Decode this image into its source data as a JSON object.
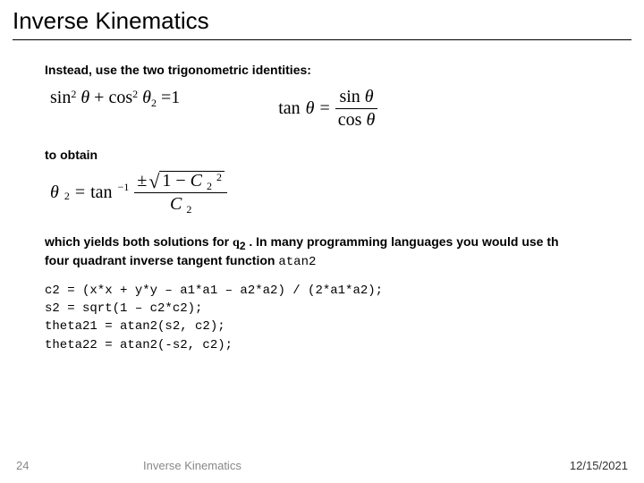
{
  "title": "Inverse Kinematics",
  "intro": "Instead, use the two trigonometric identities:",
  "eq1": {
    "sin": "sin",
    "sq1": "2",
    "theta1": "θ",
    "plus": "+",
    "cos": "cos",
    "sq2": "2",
    "theta2": "θ",
    "sub2": "2",
    "eq": "=",
    "one": "1"
  },
  "eq2": {
    "tan": "tan",
    "theta": "θ",
    "eq": "=",
    "num_sin": "sin",
    "num_theta": "θ",
    "den_cos": "cos",
    "den_theta": "θ"
  },
  "to_obtain": "to obtain",
  "eq3": {
    "theta": "θ",
    "sub2": "2",
    "eq": "=",
    "tan": "tan",
    "inv": "−1",
    "pm": "±",
    "one": "1",
    "minus": "−",
    "C": "C",
    "Csub": "2",
    "Csq": "2",
    "denC": "C",
    "denCsub": "2"
  },
  "para": {
    "t1": "which yields both solutions for ",
    "sym": "q",
    "sub": "2",
    "t2": " . In many programming languages you would use th",
    "t3": "four quadrant inverse tangent function ",
    "fn": "atan2"
  },
  "code": {
    "l1": "c2 = (x*x + y*y – a1*a1 – a2*a2) / (2*a1*a2);",
    "l2": "s2 = sqrt(1 – c2*c2);",
    "l3": "theta21 = atan2(s2, c2);",
    "l4": "theta22 = atan2(-s2, c2);"
  },
  "footer": {
    "page": "24",
    "title": "Inverse Kinematics",
    "date": "12/15/2021"
  }
}
